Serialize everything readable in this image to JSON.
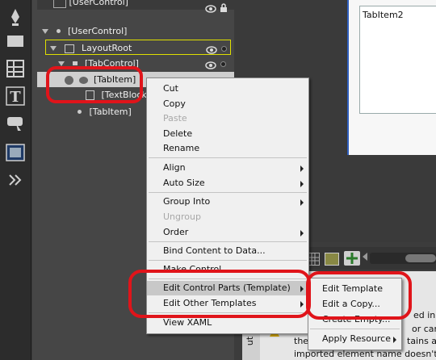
{
  "objects_panel": {
    "root_row": "[UserControl]",
    "tree": [
      {
        "label": "[UserControl]"
      },
      {
        "label": "LayoutRoot"
      },
      {
        "label": "[TabControl]"
      },
      {
        "label": "[TabItem]"
      },
      {
        "label": "[TextBlock]"
      },
      {
        "label": "[TabItem]"
      }
    ]
  },
  "artboard": {
    "tab_label": "TabItem2"
  },
  "context_menu": {
    "items": {
      "cut": "Cut",
      "copy": "Copy",
      "paste": "Paste",
      "delete": "Delete",
      "rename": "Rename",
      "align": "Align",
      "auto_size": "Auto Size",
      "group_into": "Group Into",
      "ungroup": "Ungroup",
      "order": "Order",
      "bind_content": "Bind Content to Data...",
      "make_control": "Make Control...",
      "edit_control_parts": "Edit Control Parts (Template)",
      "edit_other_templates": "Edit Other Templates",
      "view_xaml": "View XAML"
    }
  },
  "submenu": {
    "items": {
      "edit_template": "Edit Template",
      "edit_copy": "Edit a Copy...",
      "create_empty": "Create Empty...",
      "apply_resource": "Apply Resource"
    }
  },
  "message_panel": {
    "line1": "ed in the ",
    "line2": " or canno",
    "line3_prefix": "the",
    "line3_suffix": "tains at le",
    "line4": "imported element name doesn't use",
    "tab_label": "ut"
  },
  "colors": {
    "highlight_red": "#e0141a",
    "selection_outline": "#e0e000",
    "artboard_border": "#3060c0"
  }
}
